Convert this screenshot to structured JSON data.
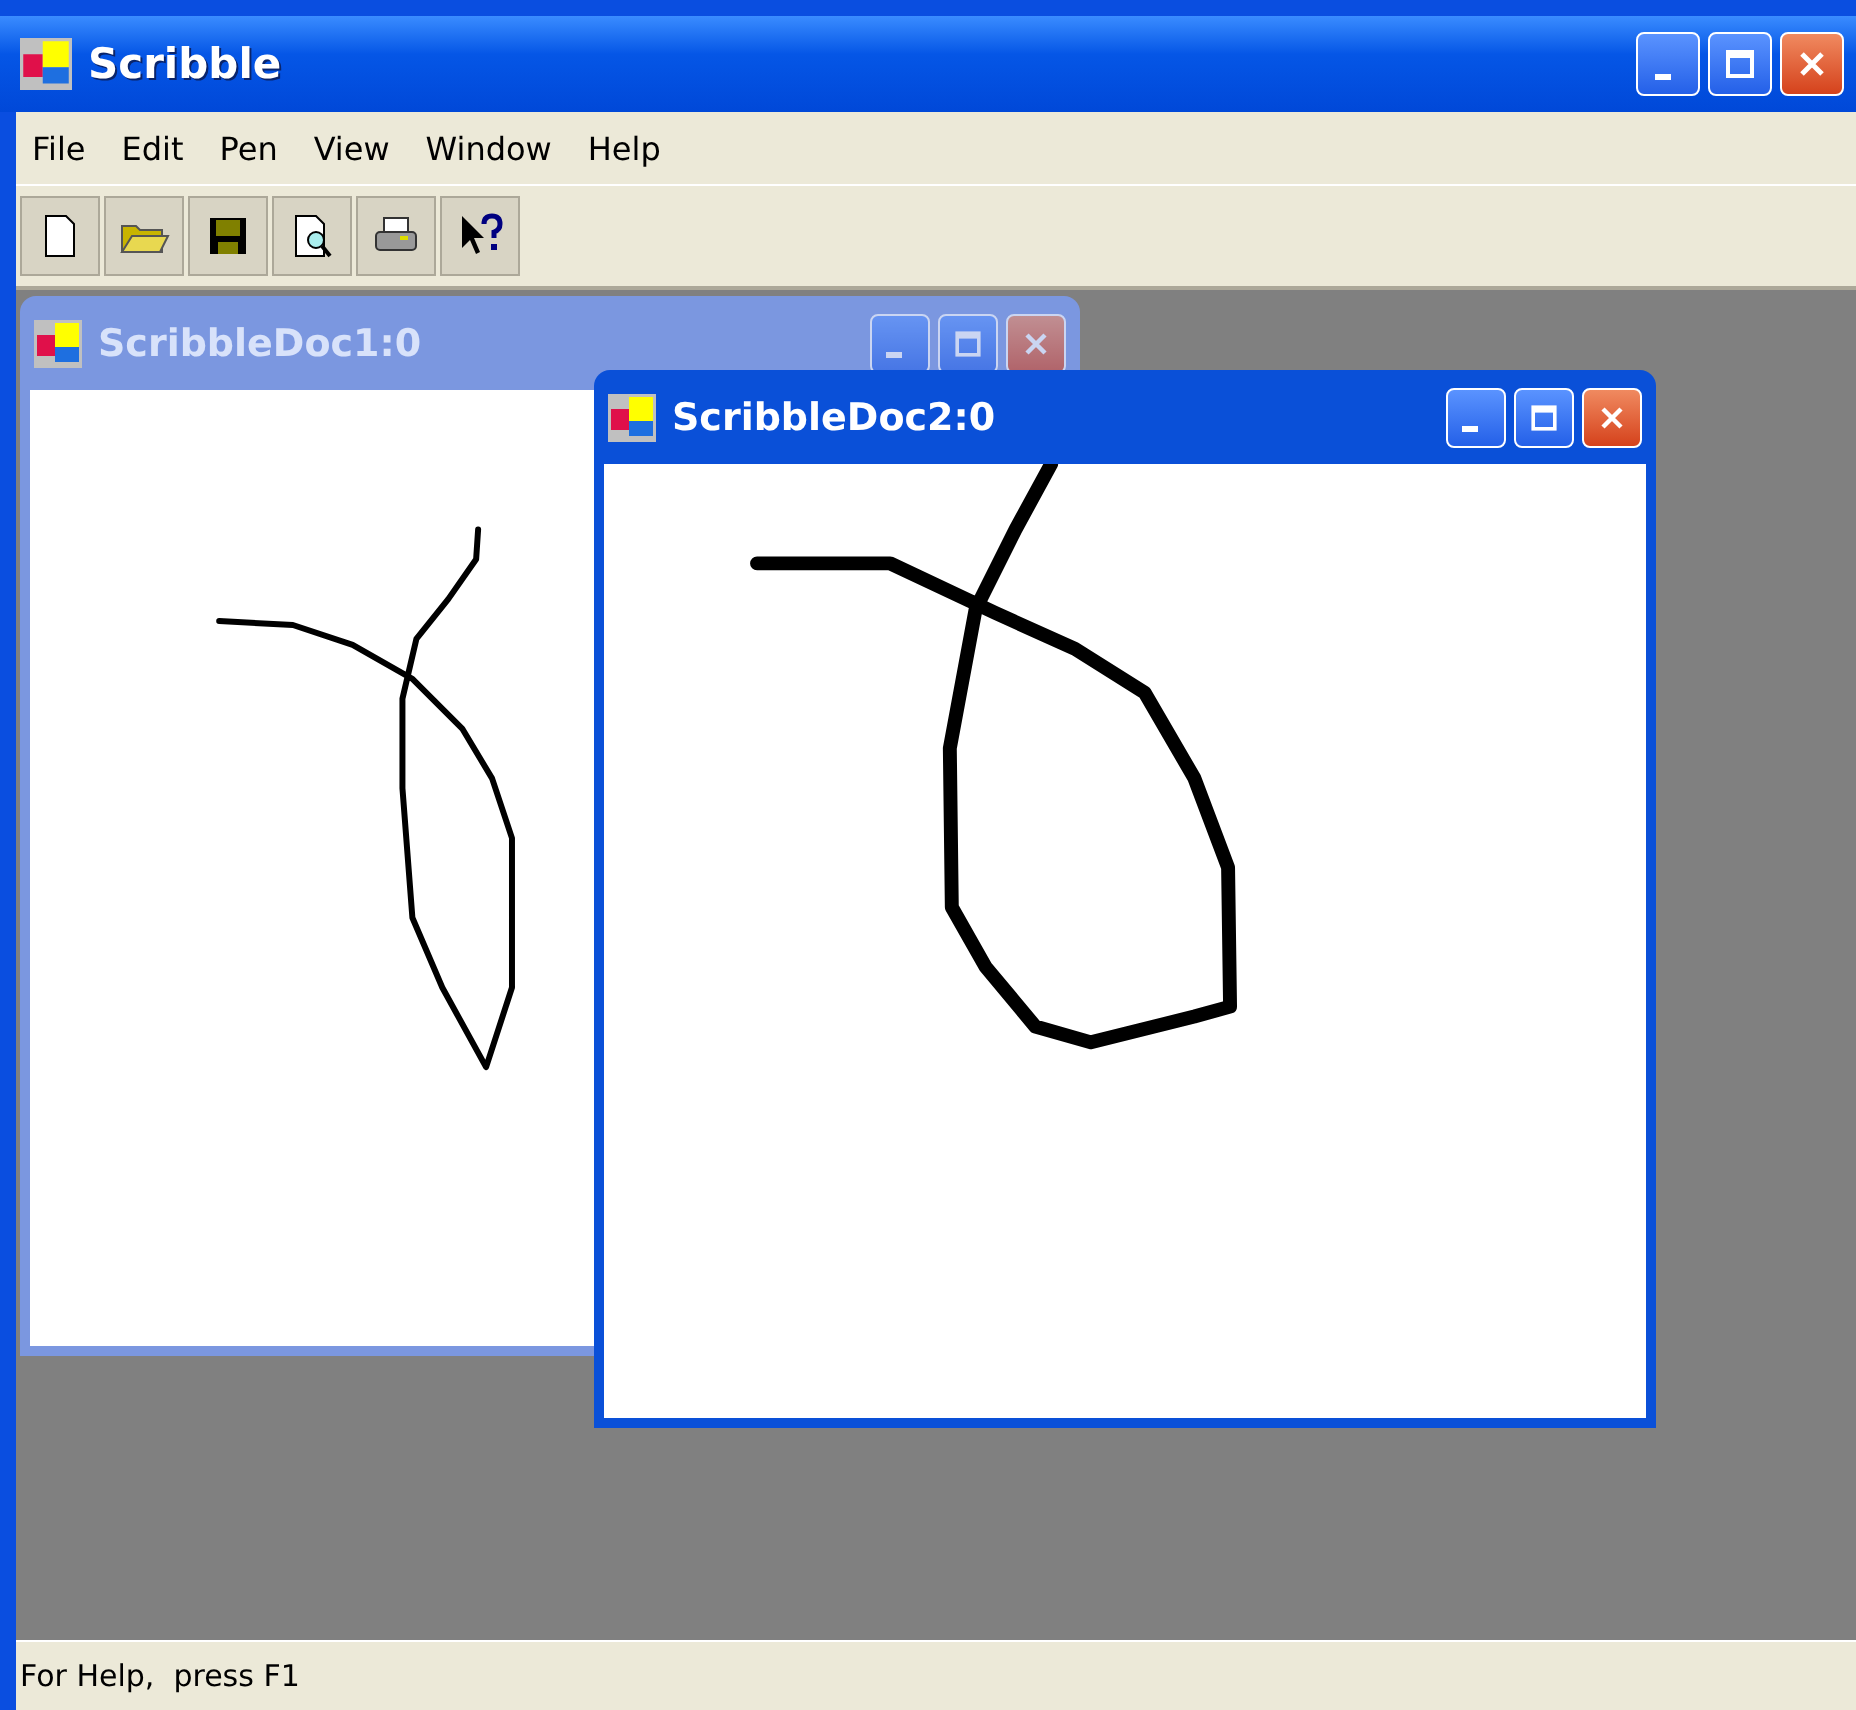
{
  "window": {
    "title": "Scribble"
  },
  "menu": [
    "File",
    "Edit",
    "Pen",
    "View",
    "Window",
    "Help"
  ],
  "documents": [
    {
      "title": "ScribbleDoc1:0",
      "active": false
    },
    {
      "title": "ScribbleDoc2:0",
      "active": true
    }
  ],
  "status_bar": {
    "text": "For Help,  press F1"
  }
}
